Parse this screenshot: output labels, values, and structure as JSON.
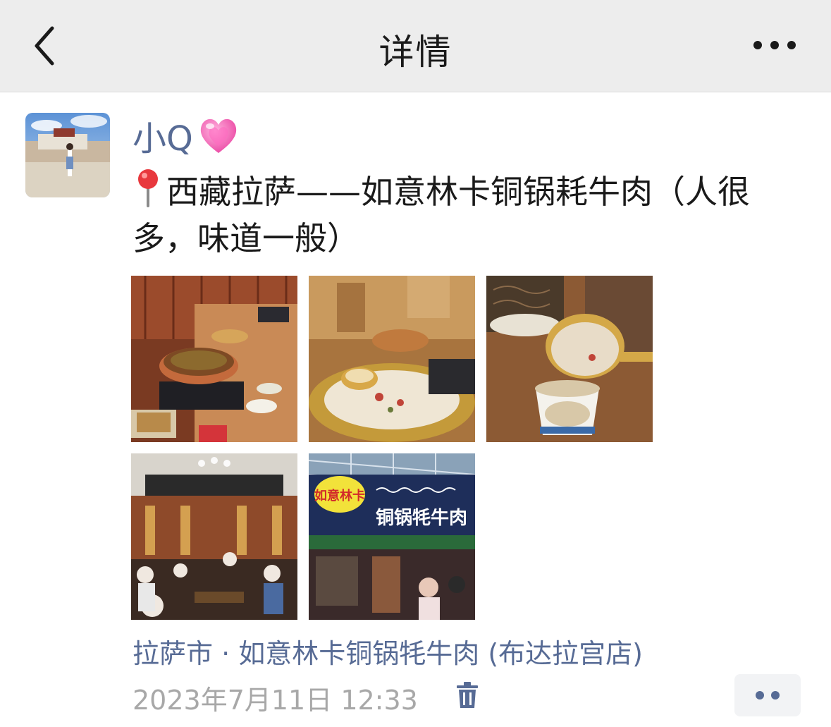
{
  "header": {
    "title": "详情"
  },
  "post": {
    "username": "小Q",
    "pin_emoji": "📍",
    "text": "西藏拉萨——如意林卡铜锅耗牛肉（人很多，味道一般）",
    "location": "拉萨市 · 如意林卡铜锅牦牛肉 (布达拉宫店)",
    "timestamp": "2023年7月11日 12:33",
    "photos": [
      {
        "name": "photo-hotpot-table"
      },
      {
        "name": "photo-copper-pot-closeup"
      },
      {
        "name": "photo-butter-tea"
      },
      {
        "name": "photo-restaurant-interior"
      },
      {
        "name": "photo-restaurant-storefront"
      }
    ],
    "storefront_sign": "如意林卡",
    "storefront_banner": "铜锅牦牛肉"
  },
  "icons": {
    "back": "chevron-left-icon",
    "more": "more-horizontal-icon",
    "heart": "pink-heart-emoji",
    "pin": "pushpin-emoji",
    "delete": "trash-icon",
    "comment": "comment-more-icon"
  },
  "colors": {
    "nav_bg": "#ededed",
    "link": "#576b95",
    "time": "#a8a8a8",
    "text": "#1a1a1a"
  }
}
